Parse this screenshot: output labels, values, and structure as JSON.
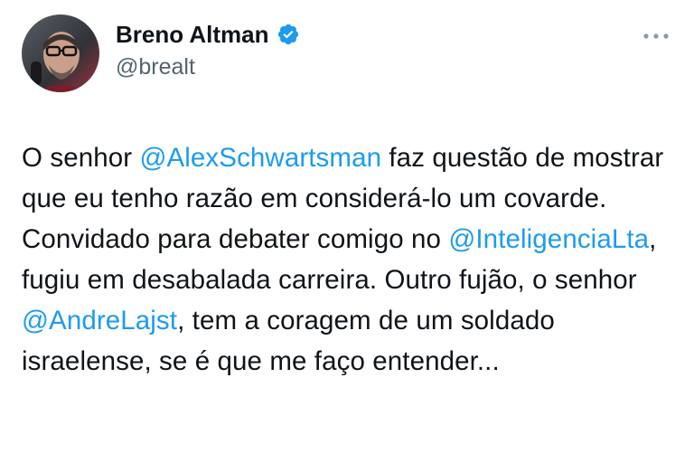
{
  "author": {
    "display_name": "Breno Altman",
    "handle": "@brealt",
    "verified_icon": "verified-badge-icon",
    "avatar_icon": "avatar"
  },
  "menu": {
    "icon": "more-options-icon"
  },
  "tweet": {
    "segments": [
      {
        "text": "O senhor ",
        "mention": false
      },
      {
        "text": "@AlexSchwartsman",
        "mention": true
      },
      {
        "text": " faz questão de mostrar que eu tenho razão em considerá-lo um covarde. Convidado para debater comigo no ",
        "mention": false
      },
      {
        "text": "@InteligenciaLta",
        "mention": true
      },
      {
        "text": ", fugiu em desabalada carreira. Outro fujão, o senhor ",
        "mention": false
      },
      {
        "text": "@AndreLajst",
        "mention": true
      },
      {
        "text": ", tem a coragem de um soldado israelense, se é que me faço entender...",
        "mention": false
      }
    ]
  },
  "colors": {
    "mention": "#1d9bf0",
    "text": "#0f1419",
    "secondary": "#536471",
    "verified": "#1d9bf0"
  }
}
